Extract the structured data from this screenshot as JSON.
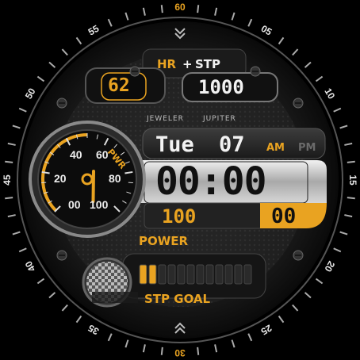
{
  "bezel": {
    "minute_labels": [
      "60",
      "05",
      "10",
      "15",
      "20",
      "25",
      "30",
      "35",
      "40",
      "45",
      "50",
      "55"
    ]
  },
  "heart_rate": {
    "label": "HR",
    "value": "62"
  },
  "steps_label": {
    "hr": "HR",
    "plus": "+",
    "stp": "STP"
  },
  "steps": {
    "value": "1000",
    "goal_label": "STP GOAL",
    "progress_fraction": 0.1
  },
  "brand": {
    "maker": "JEWELER",
    "model": "JUPITER"
  },
  "gauge": {
    "label": "PWR",
    "ticks": [
      "0",
      "20",
      "40",
      "60",
      "80",
      "100"
    ],
    "tick_00": "00",
    "value": 0.1
  },
  "date": {
    "weekday": "Tue",
    "day": "07",
    "am": "AM",
    "pm": "PM",
    "active_period": "AM"
  },
  "time": {
    "display": "00:00",
    "seconds": "00"
  },
  "power": {
    "value": "100",
    "label": "POWER"
  },
  "colors": {
    "accent": "#e9a321",
    "panel": "#2a2a2a",
    "text": "#f2f2f2"
  }
}
